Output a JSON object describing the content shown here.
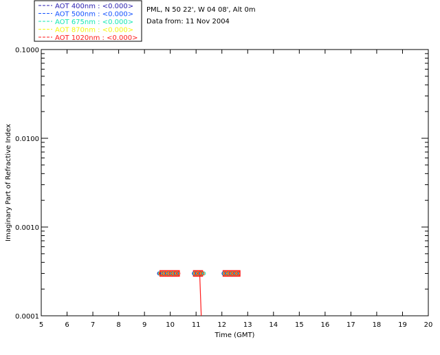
{
  "legend": [
    {
      "label": "AOT  400nm : <0.000>",
      "color": "#2a1fb0"
    },
    {
      "label": "AOT  500nm : <0.000>",
      "color": "#1452ff"
    },
    {
      "label": "AOT  675nm : <0.000>",
      "color": "#15e8b4"
    },
    {
      "label": "AOT  870nm : <0.000>",
      "color": "#f6f60e"
    },
    {
      "label": "AOT 1020nm : <0.000>",
      "color": "#ff1a1a"
    }
  ],
  "info": {
    "location": "PML, N 50 22', W 04 08', Alt 0m",
    "date": "Data from: 11 Nov 2004"
  },
  "chart_data": {
    "type": "scatter",
    "xlabel": "Time (GMT)",
    "ylabel": "Imaginary Part of Refractive Index",
    "xlim": [
      5,
      20
    ],
    "ylim": [
      0.0001,
      0.1
    ],
    "yscale": "log",
    "x_ticks": [
      "5",
      "6",
      "7",
      "8",
      "9",
      "10",
      "11",
      "12",
      "13",
      "14",
      "15",
      "16",
      "17",
      "18",
      "19",
      "20"
    ],
    "y_ticks": [
      "0.0001",
      "0.0010",
      "0.0100",
      "0.1000"
    ],
    "grid": false,
    "series": [
      {
        "name": "AOT  400nm : <0.000>",
        "x": [
          9.6,
          9.78,
          9.96,
          10.14,
          10.28,
          10.95,
          11.1,
          11.22,
          12.1,
          12.28,
          12.44,
          12.6
        ],
        "y": [
          0.0003,
          0.0003,
          0.0003,
          0.0003,
          0.0003,
          0.0003,
          0.0003,
          0.0003,
          0.0003,
          0.0003,
          0.0003,
          0.0003
        ]
      },
      {
        "name": "AOT  500nm : <0.000>",
        "x": [
          9.6,
          9.78,
          9.96,
          10.14,
          10.28,
          10.95,
          11.1,
          11.22,
          12.1,
          12.28,
          12.44,
          12.6
        ],
        "y": [
          0.0003,
          0.0003,
          0.0003,
          0.0003,
          0.0003,
          0.0003,
          0.0003,
          0.0003,
          0.0003,
          0.0003,
          0.0003,
          0.0003
        ]
      },
      {
        "name": "AOT  675nm : <0.000>",
        "x": [
          9.6,
          9.78,
          9.96,
          10.14,
          10.28,
          10.95,
          11.1,
          11.22,
          11.3,
          12.1,
          12.28,
          12.44,
          12.6
        ],
        "y": [
          0.0003,
          0.0003,
          0.0003,
          0.0003,
          0.0003,
          0.0003,
          0.0003,
          0.0003,
          0.0003,
          0.0003,
          0.0003,
          0.0003,
          0.0003
        ]
      },
      {
        "name": "AOT  870nm : <0.000>",
        "x": [
          9.6,
          9.78,
          9.96,
          10.14,
          10.28,
          10.95,
          11.1,
          11.22,
          12.1,
          12.28,
          12.44,
          12.6
        ],
        "y": [
          0.0003,
          0.0003,
          0.0003,
          0.0003,
          0.0003,
          0.0003,
          0.0003,
          0.0003,
          0.0003,
          0.0003,
          0.0003,
          0.0003
        ]
      },
      {
        "name": "AOT 1020nm : <0.000>",
        "x": [
          9.6,
          9.78,
          9.96,
          10.14,
          10.28,
          10.95,
          11.1,
          11.22,
          11.18,
          12.1,
          12.28,
          12.44,
          12.6
        ],
        "y": [
          0.0003,
          0.0003,
          0.0003,
          0.0003,
          0.0003,
          0.0003,
          0.0003,
          0.0003,
          0.0001,
          0.0003,
          0.0003,
          0.0003,
          0.0003
        ]
      }
    ],
    "groups": [
      {
        "x_start": 9.6,
        "x_end": 10.35,
        "y": 0.0003
      },
      {
        "x_start": 10.9,
        "x_end": 11.25,
        "y": 0.0003
      },
      {
        "x_start": 12.05,
        "x_end": 12.7,
        "y": 0.0003
      }
    ],
    "drop_line": {
      "x_top": 11.14,
      "x_bottom": 11.2,
      "y_top": 0.0003,
      "y_bottom": 0.0001,
      "color": "#ff1a1a"
    }
  }
}
